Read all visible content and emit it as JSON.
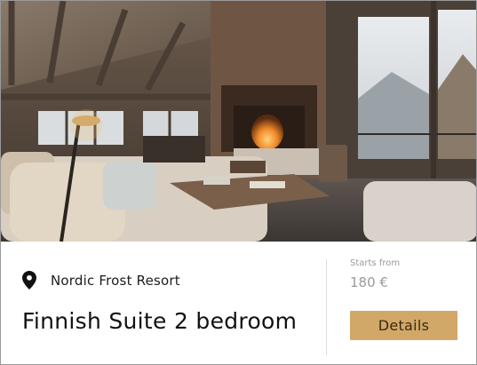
{
  "listing": {
    "location": "Nordic Frost Resort",
    "title": "Finnish Suite 2 bedroom",
    "price_caption": "Starts from",
    "price": "180 €",
    "details_label": "Details"
  },
  "photo": {
    "subject": "chalet living room with fireplace"
  },
  "colors": {
    "button_bg": "#d1a868",
    "price_text": "#9a9a9a"
  }
}
